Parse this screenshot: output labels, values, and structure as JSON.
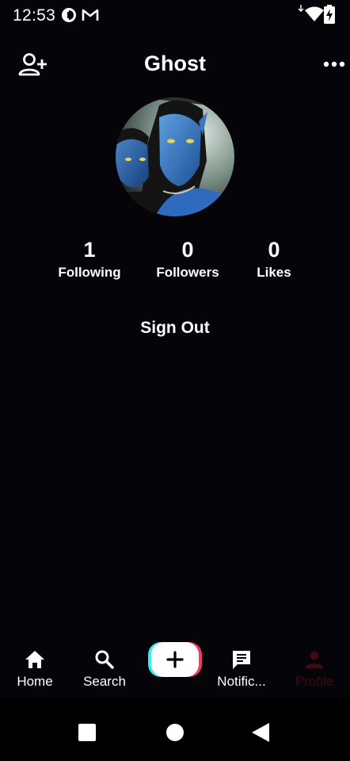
{
  "status_bar": {
    "time": "12:53",
    "icons": [
      "pie-status-icon",
      "gmail-icon",
      "download-arrow-icon",
      "wifi-icon",
      "battery-charging-icon"
    ]
  },
  "header": {
    "title": "Ghost",
    "left_icon": "add-user-icon",
    "right_icon": "more-horizontal-icon"
  },
  "profile": {
    "avatar_icon": "profile-avatar-image",
    "stats": [
      {
        "value": "1",
        "label": "Following"
      },
      {
        "value": "0",
        "label": "Followers"
      },
      {
        "value": "0",
        "label": "Likes"
      }
    ],
    "sign_out": "Sign Out"
  },
  "bottom_nav": {
    "items": [
      {
        "label": "Home",
        "icon": "home-icon"
      },
      {
        "label": "Search",
        "icon": "search-icon"
      },
      {
        "label": "",
        "icon": "plus-icon"
      },
      {
        "label": "Notific...",
        "icon": "message-icon"
      },
      {
        "label": "Profile",
        "icon": "person-icon"
      }
    ],
    "active_color": "#3d0b10"
  },
  "colors": {
    "background": "#050509",
    "text": "#ffffff",
    "create_cyan": "#3ee8f0",
    "create_pink": "#f23a6c"
  }
}
